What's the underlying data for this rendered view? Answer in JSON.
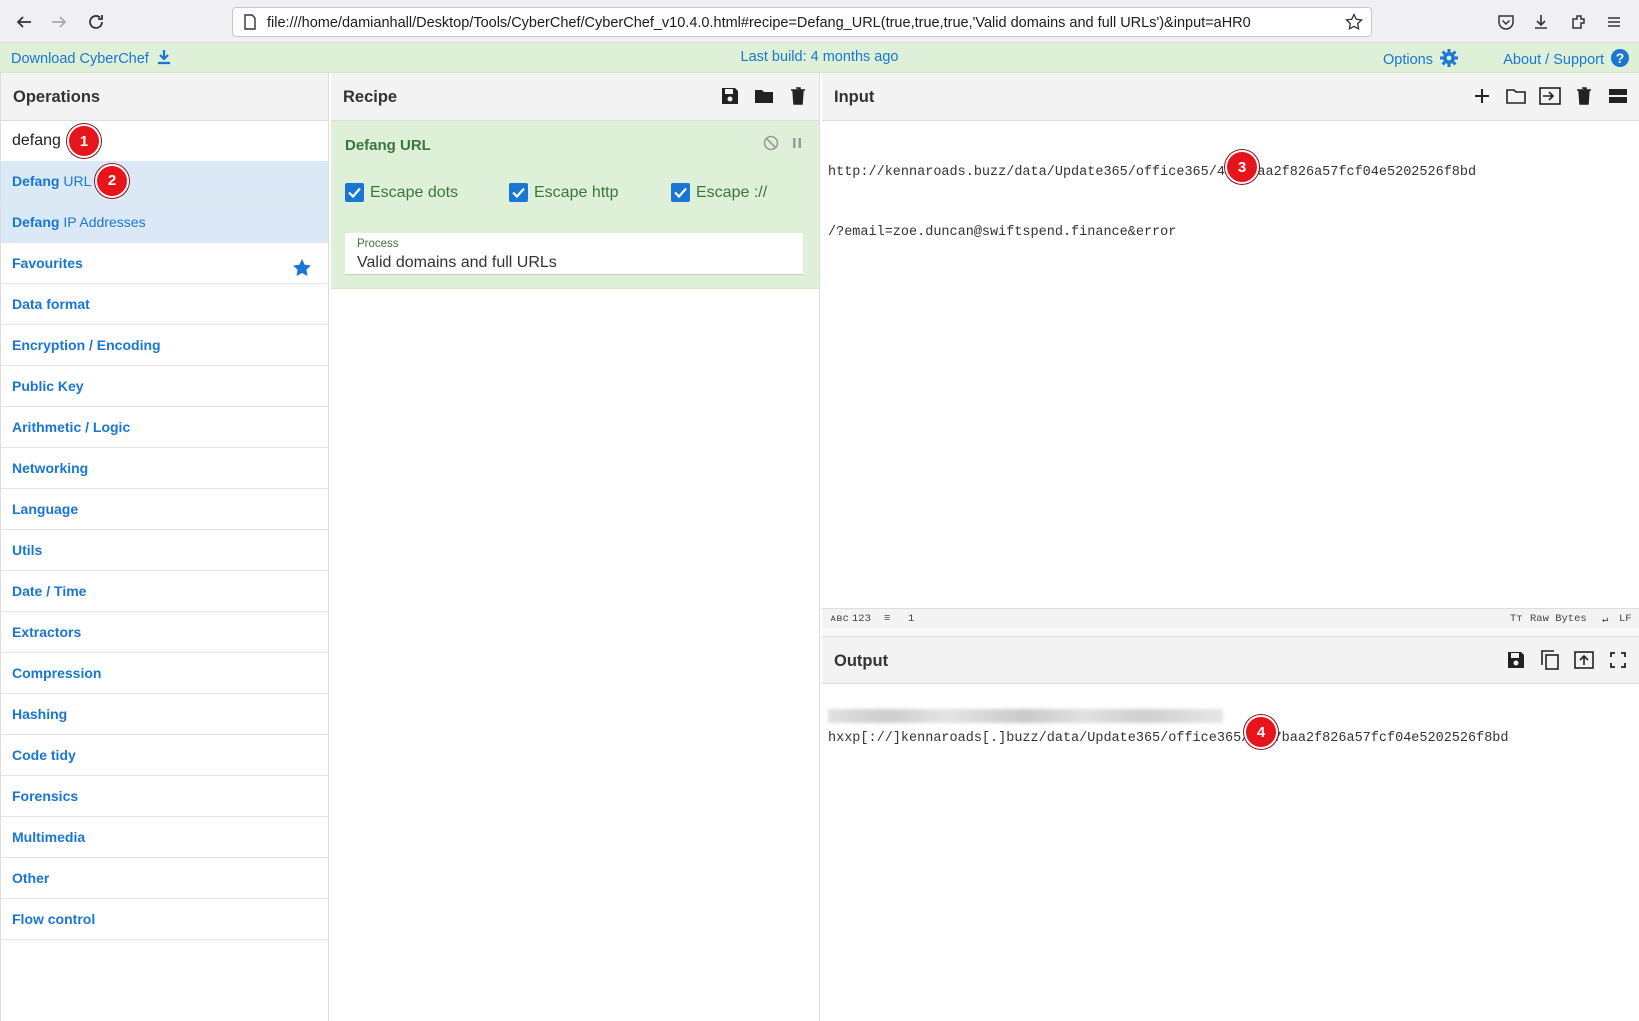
{
  "browser": {
    "url": "file:///home/damianhall/Desktop/Tools/CyberChef/CyberChef_v10.4.0.html#recipe=Defang_URL(true,true,true,'Valid domains and full URLs')&input=aHR0"
  },
  "banner": {
    "download": "Download CyberChef",
    "last_build": "Last build: 4 months ago",
    "options": "Options",
    "about": "About / Support"
  },
  "operations": {
    "title": "Operations",
    "search_value": "defang",
    "results": [
      {
        "bold": "Defang",
        "rest": " URL"
      },
      {
        "bold": "Defang",
        "rest": " IP Addresses"
      }
    ],
    "categories": [
      "Favourites",
      "Data format",
      "Encryption / Encoding",
      "Public Key",
      "Arithmetic / Logic",
      "Networking",
      "Language",
      "Utils",
      "Date / Time",
      "Extractors",
      "Compression",
      "Hashing",
      "Code tidy",
      "Forensics",
      "Multimedia",
      "Other",
      "Flow control"
    ]
  },
  "recipe": {
    "title": "Recipe",
    "op_title": "Defang URL",
    "checkboxes": [
      "Escape dots",
      "Escape http",
      "Escape ://"
    ],
    "process_label": "Process",
    "process_value": "Valid domains and full URLs"
  },
  "input": {
    "title": "Input",
    "line1": "http://kennaroads.buzz/data/Update365/office365/40e7baa2f826a57fcf04e5202526f8bd",
    "line2": "/?email=zoe.duncan@swiftspend.finance&error",
    "status_chars": "123",
    "status_lines": "1",
    "status_encoding": "Raw Bytes",
    "status_eol": "LF"
  },
  "output": {
    "title": "Output",
    "line1": "hxxp[://]kennaroads[.]buzz/data/Update365/office365/40e7baa2f826a57fcf04e5202526f8bd"
  },
  "markers": [
    "1",
    "2",
    "3",
    "4"
  ],
  "colors": {
    "link": "#1976d2",
    "recipe_bg": "#dff0d8",
    "marker": "#e8141c"
  }
}
